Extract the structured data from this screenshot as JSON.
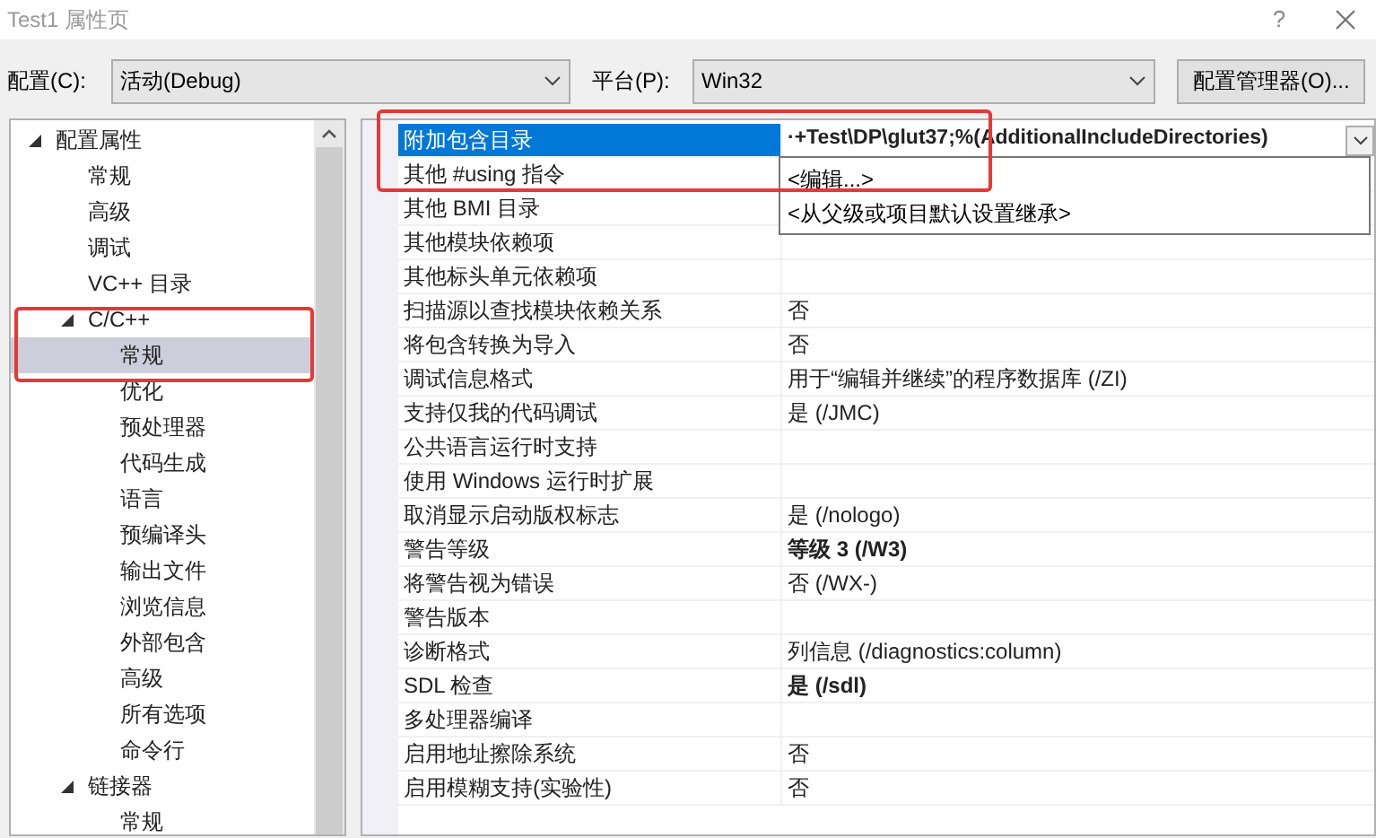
{
  "window": {
    "title": "Test1 属性页",
    "help": "?"
  },
  "toolbar": {
    "config_label": "配置(C):",
    "config_value": "活动(Debug)",
    "platform_label": "平台(P):",
    "platform_value": "Win32",
    "manager_button": "配置管理器(O)..."
  },
  "tree": [
    {
      "label": "配置属性",
      "expanded": true,
      "selected": false,
      "children": [
        {
          "label": "常规",
          "selected": false
        },
        {
          "label": "高级",
          "selected": false
        },
        {
          "label": "调试",
          "selected": false
        },
        {
          "label": "VC++ 目录",
          "selected": false
        },
        {
          "label": "C/C++",
          "expanded": true,
          "selected": false,
          "children": [
            {
              "label": "常规",
              "selected": true
            },
            {
              "label": "优化",
              "selected": false
            },
            {
              "label": "预处理器",
              "selected": false
            },
            {
              "label": "代码生成",
              "selected": false
            },
            {
              "label": "语言",
              "selected": false
            },
            {
              "label": "预编译头",
              "selected": false
            },
            {
              "label": "输出文件",
              "selected": false
            },
            {
              "label": "浏览信息",
              "selected": false
            },
            {
              "label": "外部包含",
              "selected": false
            },
            {
              "label": "高级",
              "selected": false
            },
            {
              "label": "所有选项",
              "selected": false
            },
            {
              "label": "命令行",
              "selected": false
            }
          ]
        },
        {
          "label": "链接器",
          "expanded": true,
          "selected": false,
          "children": [
            {
              "label": "常规",
              "selected": false
            }
          ]
        }
      ]
    }
  ],
  "properties": [
    {
      "name": "附加包含目录",
      "value": "·+Test\\DP\\glut37;%(AdditionalIncludeDirectories)",
      "bold": true,
      "selected": true
    },
    {
      "name": "其他 #using 指令",
      "selected": false
    },
    {
      "name": "其他 BMI 目录",
      "selected": false
    },
    {
      "name": "其他模块依赖项",
      "selected": false
    },
    {
      "name": "其他标头单元依赖项",
      "selected": false
    },
    {
      "name": "扫描源以查找模块依赖关系",
      "value": "否",
      "bold": false,
      "selected": false
    },
    {
      "name": "将包含转换为导入",
      "value": "否",
      "bold": false,
      "selected": false
    },
    {
      "name": "调试信息格式",
      "value": "用于“编辑并继续”的程序数据库 (/ZI)",
      "bold": false,
      "selected": false
    },
    {
      "name": "支持仅我的代码调试",
      "value": "是 (/JMC)",
      "bold": false,
      "selected": false
    },
    {
      "name": "公共语言运行时支持",
      "selected": false
    },
    {
      "name": "使用 Windows 运行时扩展",
      "selected": false
    },
    {
      "name": "取消显示启动版权标志",
      "value": "是 (/nologo)",
      "bold": false,
      "selected": false
    },
    {
      "name": "警告等级",
      "value": "等级 3 (/W3)",
      "bold": true,
      "selected": false
    },
    {
      "name": "将警告视为错误",
      "value": "否 (/WX-)",
      "bold": false,
      "selected": false
    },
    {
      "name": "警告版本",
      "selected": false
    },
    {
      "name": "诊断格式",
      "value": "列信息 (/diagnostics:column)",
      "bold": false,
      "selected": false
    },
    {
      "name": "SDL 检查",
      "value": "是 (/sdl)",
      "bold": true,
      "selected": false
    },
    {
      "name": "多处理器编译",
      "selected": false
    },
    {
      "name": "启用地址擦除系统",
      "value": "否",
      "bold": false,
      "selected": false
    },
    {
      "name": "启用模糊支持(实验性)",
      "value": "否",
      "bold": false,
      "selected": false
    }
  ],
  "dropdown": {
    "options": [
      "<编辑...>",
      "<从父级或项目默认设置继承>"
    ]
  }
}
